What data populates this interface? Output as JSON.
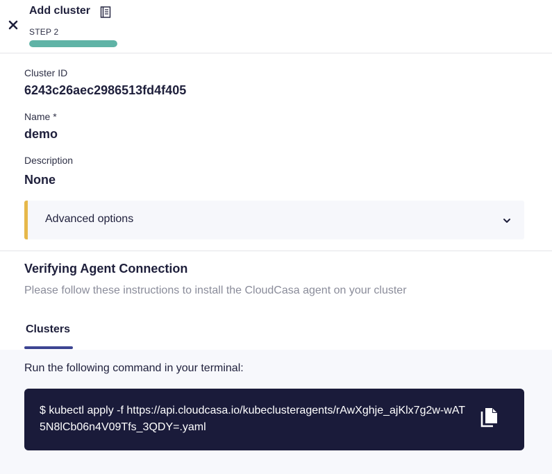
{
  "header": {
    "title": "Add cluster",
    "step_label": "STEP 2",
    "progress_fraction": 1.0,
    "icons": {
      "close": "close-icon",
      "doc": "document-icon"
    }
  },
  "fields": {
    "cluster_id_label": "Cluster ID",
    "cluster_id_value": "6243c26aec2986513fd4f405",
    "name_label": "Name *",
    "name_value": "demo",
    "description_label": "Description",
    "description_value": "None"
  },
  "advanced": {
    "label": "Advanced options",
    "icon": "chevron-down-icon",
    "accent_color": "#e6b84a"
  },
  "verify": {
    "title": "Verifying Agent Connection",
    "subtitle": "Please follow these instructions to install the CloudCasa agent on your cluster"
  },
  "tabs": [
    {
      "label": "Clusters",
      "active": true
    }
  ],
  "panel": {
    "instruction": "Run the following command in your terminal:",
    "command": "$ kubectl apply -f https://api.cloudcasa.io/kubeclusteragents/rAwXghje_ajKlx7g2w-wAT5N8lCb06n4V09Tfs_3QDY=.yaml",
    "copy_icon": "copy-icon"
  },
  "colors": {
    "progress": "#5fb3a6",
    "tab_underline": "#3d4592",
    "command_bg": "#1a1b3a"
  }
}
